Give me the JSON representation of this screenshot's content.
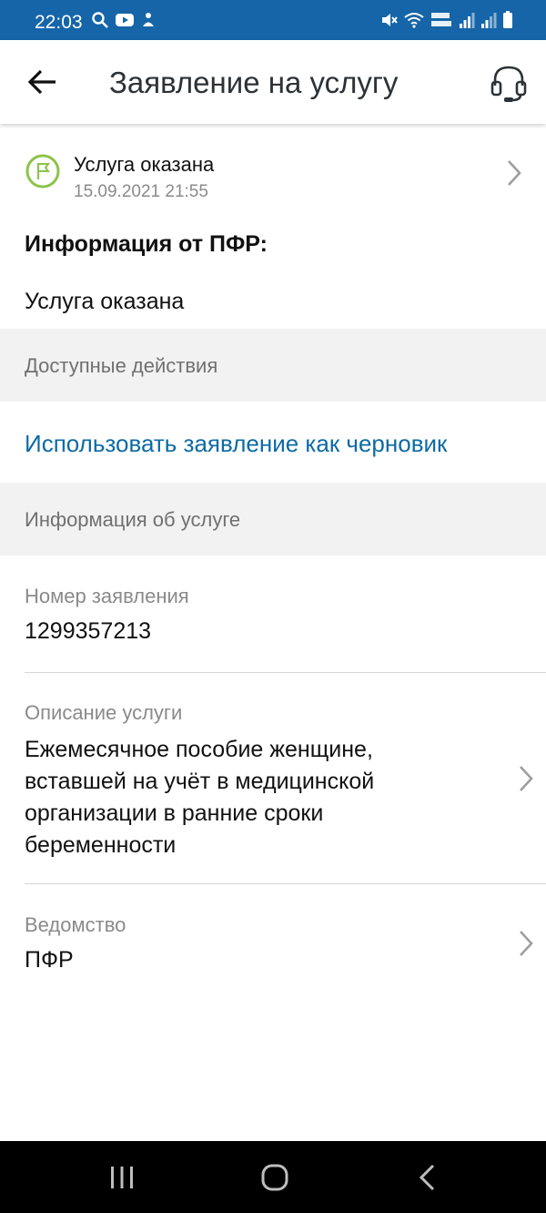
{
  "status_bar": {
    "time": "22:03",
    "left_icons": [
      "search-icon",
      "youtube-icon",
      "notification-icon"
    ],
    "right_icons": [
      "mute-icon",
      "wifi-icon",
      "volte-lte-icon",
      "signal-icon",
      "signal-icon",
      "battery-icon"
    ],
    "network_label": "Vo)) LTE1"
  },
  "app_bar": {
    "title": "Заявление на услугу",
    "back_icon": "back-arrow-icon",
    "support_icon": "headset-icon"
  },
  "status": {
    "icon": "flag-icon",
    "label": "Услуга оказана",
    "date": "15.09.2021 21:55",
    "accent_color": "#8bc34a"
  },
  "pfr_info": {
    "heading": "Информация от ПФР:",
    "text": "Услуга оказана"
  },
  "actions_section": {
    "header": "Доступные действия",
    "link": "Использовать заявление как черновик",
    "link_color": "#0d6aa6"
  },
  "service_section": {
    "header": "Информация об услуге"
  },
  "fields": {
    "application_number": {
      "label": "Номер заявления",
      "value": "1299357213"
    },
    "description": {
      "label": "Описание услуги",
      "lines": [
        "Ежемесячное пособие женщине,",
        "вставшей на учёт в медицинской",
        "организации в ранние сроки",
        "беременности"
      ]
    },
    "agency": {
      "label": "Ведомство",
      "value": "ПФР"
    }
  },
  "nav_bar": {
    "buttons": [
      "recents-icon",
      "home-icon",
      "back-icon"
    ]
  }
}
